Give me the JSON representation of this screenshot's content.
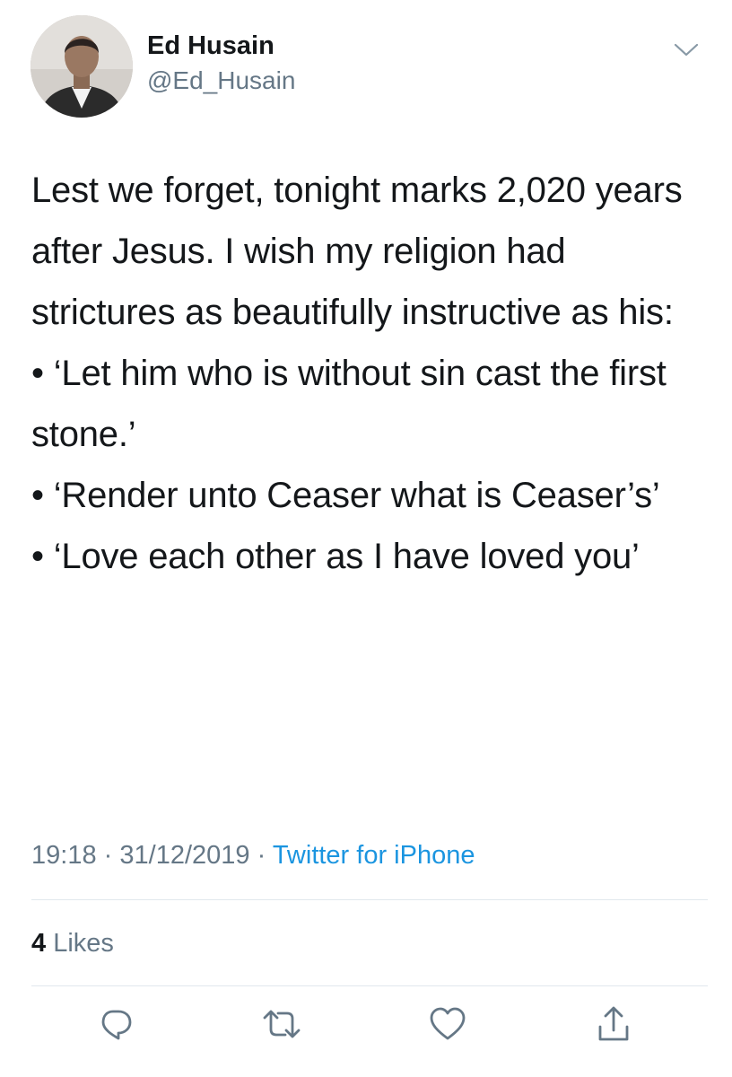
{
  "author": {
    "display_name": "Ed Husain",
    "handle": "@Ed_Husain",
    "avatar_icon": "profile-photo"
  },
  "tweet": {
    "intro": "Lest we forget, tonight marks 2,020 years after Jesus. I wish my religion had strictures as beautifully instructive as his:",
    "quotes": [
      "• ‘Let him who is without sin cast the first stone.’",
      "• ‘Render unto Ceaser what is Ceaser’s’",
      "• ‘Love each other as I have loved you’"
    ]
  },
  "meta": {
    "time": "19:18",
    "separator": "·",
    "date": "31/12/2019",
    "source": "Twitter for iPhone"
  },
  "likes": {
    "count": "4",
    "label": "Likes"
  },
  "actions": {
    "reply_icon": "reply-icon",
    "retweet_icon": "retweet-icon",
    "like_icon": "heart-icon",
    "share_icon": "share-icon"
  },
  "colors": {
    "text": "#14171a",
    "secondary": "#657786",
    "link": "#1b95e0",
    "divider": "#e1e8ed"
  }
}
